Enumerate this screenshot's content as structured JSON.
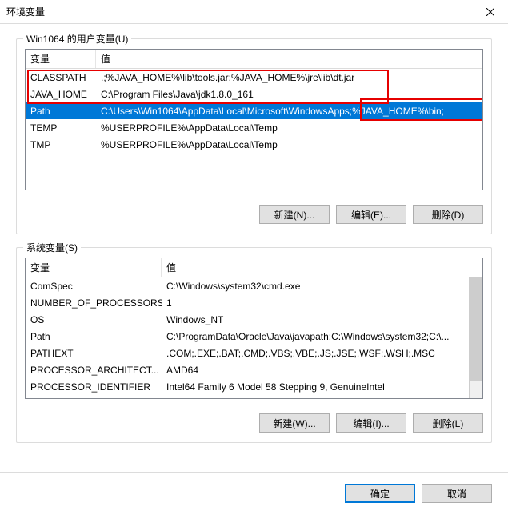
{
  "window": {
    "title": "环境变量"
  },
  "userVars": {
    "groupLabel": "Win1064 的用户变量(U)",
    "headers": {
      "name": "变量",
      "value": "值"
    },
    "rows": [
      {
        "name": "CLASSPATH",
        "value": ".;%JAVA_HOME%\\lib\\tools.jar;%JAVA_HOME%\\jre\\lib\\dt.jar"
      },
      {
        "name": "JAVA_HOME",
        "value": "C:\\Program Files\\Java\\jdk1.8.0_161"
      },
      {
        "name": "Path",
        "value": "C:\\Users\\Win1064\\AppData\\Local\\Microsoft\\WindowsApps;%JAVA_HOME%\\bin;"
      },
      {
        "name": "TEMP",
        "value": "%USERPROFILE%\\AppData\\Local\\Temp"
      },
      {
        "name": "TMP",
        "value": "%USERPROFILE%\\AppData\\Local\\Temp"
      }
    ],
    "buttons": {
      "new": "新建(N)...",
      "edit": "编辑(E)...",
      "delete": "删除(D)"
    }
  },
  "sysVars": {
    "groupLabel": "系统变量(S)",
    "headers": {
      "name": "变量",
      "value": "值"
    },
    "rows": [
      {
        "name": "ComSpec",
        "value": "C:\\Windows\\system32\\cmd.exe"
      },
      {
        "name": "NUMBER_OF_PROCESSORS",
        "value": "1"
      },
      {
        "name": "OS",
        "value": "Windows_NT"
      },
      {
        "name": "Path",
        "value": "C:\\ProgramData\\Oracle\\Java\\javapath;C:\\Windows\\system32;C:\\..."
      },
      {
        "name": "PATHEXT",
        "value": ".COM;.EXE;.BAT;.CMD;.VBS;.VBE;.JS;.JSE;.WSF;.WSH;.MSC"
      },
      {
        "name": "PROCESSOR_ARCHITECT...",
        "value": "AMD64"
      },
      {
        "name": "PROCESSOR_IDENTIFIER",
        "value": "Intel64 Family 6 Model 58 Stepping 9, GenuineIntel"
      }
    ],
    "buttons": {
      "new": "新建(W)...",
      "edit": "编辑(I)...",
      "delete": "删除(L)"
    }
  },
  "footer": {
    "ok": "确定",
    "cancel": "取消"
  },
  "layout": {
    "userCol1Width": 88,
    "sysCol1Width": 170,
    "selectedUserIndex": 2,
    "highlights": {
      "redBox1": true,
      "redBox2": true
    }
  }
}
